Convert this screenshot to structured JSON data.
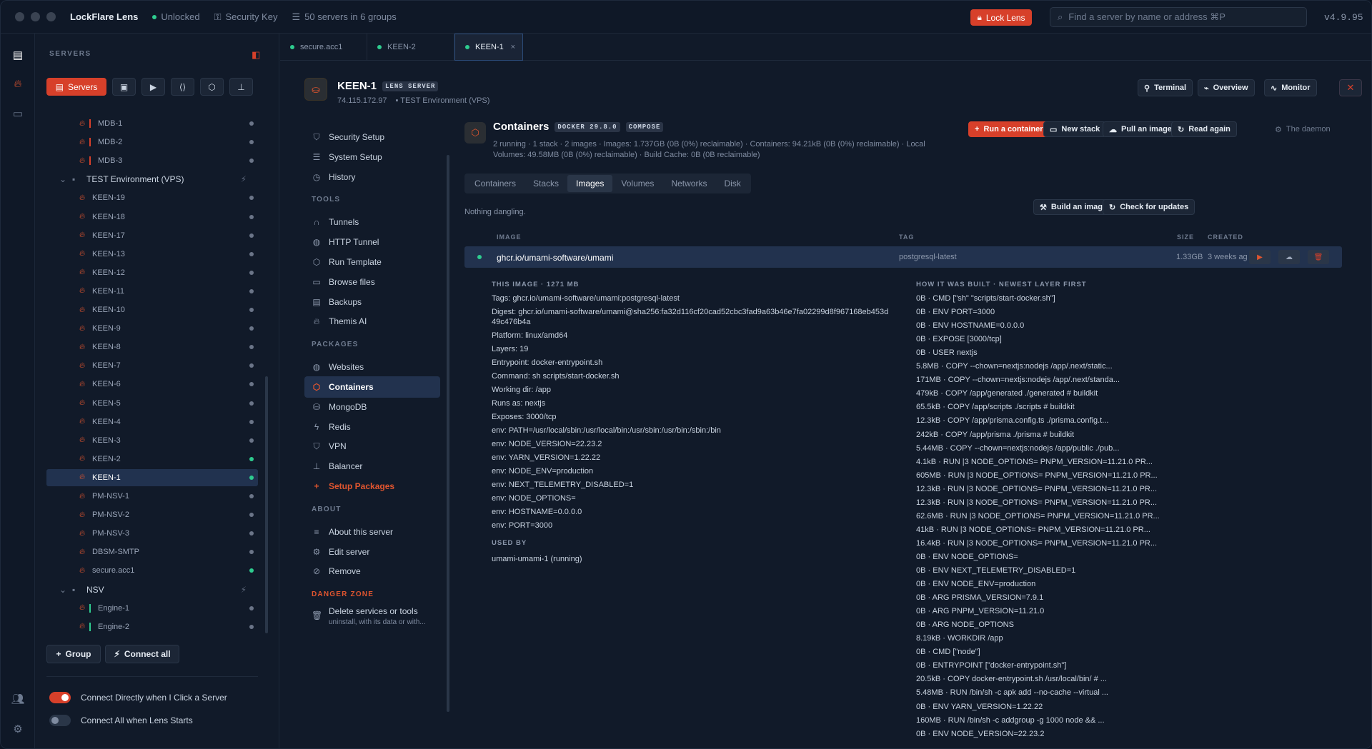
{
  "titlebar": {
    "app_name": "LockFlare Lens",
    "status": "Unlocked",
    "security_key": "Security Key",
    "servers_summary": "50 servers in 6 groups",
    "lock_btn": "Lock Lens",
    "search_placeholder": "Find a server by name or address ⌘P",
    "version": "v4.9.95"
  },
  "sidebar": {
    "title": "SERVERS",
    "servers_tab": "Servers",
    "tree": [
      {
        "label": "MDB-1",
        "kind": "server",
        "bar": "red",
        "on": false
      },
      {
        "label": "MDB-2",
        "kind": "server",
        "bar": "red",
        "on": false
      },
      {
        "label": "MDB-3",
        "kind": "server",
        "bar": "red",
        "on": false
      },
      {
        "label": "TEST Environment (VPS)",
        "kind": "group"
      },
      {
        "label": "KEEN-19",
        "kind": "server",
        "on": false
      },
      {
        "label": "KEEN-18",
        "kind": "server",
        "on": false
      },
      {
        "label": "KEEN-17",
        "kind": "server",
        "on": false
      },
      {
        "label": "KEEN-13",
        "kind": "server",
        "on": false
      },
      {
        "label": "KEEN-12",
        "kind": "server",
        "on": false
      },
      {
        "label": "KEEN-11",
        "kind": "server",
        "on": false
      },
      {
        "label": "KEEN-10",
        "kind": "server",
        "on": false
      },
      {
        "label": "KEEN-9",
        "kind": "server",
        "on": false
      },
      {
        "label": "KEEN-8",
        "kind": "server",
        "on": false
      },
      {
        "label": "KEEN-7",
        "kind": "server",
        "on": false
      },
      {
        "label": "KEEN-6",
        "kind": "server",
        "on": false
      },
      {
        "label": "KEEN-5",
        "kind": "server",
        "on": false
      },
      {
        "label": "KEEN-4",
        "kind": "server",
        "on": false
      },
      {
        "label": "KEEN-3",
        "kind": "server",
        "on": false
      },
      {
        "label": "KEEN-2",
        "kind": "server",
        "on": true
      },
      {
        "label": "KEEN-1",
        "kind": "server",
        "on": true,
        "selected": true
      },
      {
        "label": "PM-NSV-1",
        "kind": "server",
        "on": false
      },
      {
        "label": "PM-NSV-2",
        "kind": "server",
        "on": false
      },
      {
        "label": "PM-NSV-3",
        "kind": "server",
        "on": false
      },
      {
        "label": "DBSM-SMTP",
        "kind": "server",
        "on": false
      },
      {
        "label": "secure.acc1",
        "kind": "server",
        "on": true
      },
      {
        "label": "NSV",
        "kind": "group"
      },
      {
        "label": "Engine-1",
        "kind": "server",
        "bar": "green",
        "on": false
      },
      {
        "label": "Engine-2",
        "kind": "server",
        "bar": "green",
        "on": false
      }
    ],
    "group_btn": "Group",
    "connect_all_btn": "Connect all",
    "toggle1": "Connect Directly when I Click a Server",
    "toggle2": "Connect All when Lens Starts"
  },
  "tabs": [
    {
      "label": "secure.acc1",
      "active": false
    },
    {
      "label": "KEEN-2",
      "active": false
    },
    {
      "label": "KEEN-1",
      "active": true
    }
  ],
  "server": {
    "name": "KEEN-1",
    "badge": "LENS SERVER",
    "ip": "74.115.172.97",
    "env": "TEST Environment (VPS)",
    "btn_terminal": "Terminal",
    "btn_overview": "Overview",
    "btn_monitor": "Monitor"
  },
  "menu": {
    "items_top": [
      {
        "label": "Security Setup",
        "icon": "shield-icon"
      },
      {
        "label": "System Setup",
        "icon": "sliders-icon"
      },
      {
        "label": "History",
        "icon": "clock-icon"
      }
    ],
    "tools_head": "TOOLS",
    "tools": [
      {
        "label": "Tunnels",
        "icon": "tunnel-icon"
      },
      {
        "label": "HTTP Tunnel",
        "icon": "globe-icon"
      },
      {
        "label": "Run Template",
        "icon": "box-icon"
      },
      {
        "label": "Browse files",
        "icon": "folder-icon"
      },
      {
        "label": "Backups",
        "icon": "archive-icon"
      },
      {
        "label": "Themis AI",
        "icon": "flame-icon"
      }
    ],
    "packages_head": "PACKAGES",
    "packages": [
      {
        "label": "Websites",
        "icon": "globe-icon"
      },
      {
        "label": "Containers",
        "icon": "container-icon",
        "active": true
      },
      {
        "label": "MongoDB",
        "icon": "database-icon"
      },
      {
        "label": "Redis",
        "icon": "bolt-icon"
      },
      {
        "label": "VPN",
        "icon": "shield-icon"
      },
      {
        "label": "Balancer",
        "icon": "network-icon"
      },
      {
        "label": "Setup Packages",
        "icon": "plus-icon",
        "orange": true
      }
    ],
    "about_head": "ABOUT",
    "about": [
      {
        "label": "About this server",
        "icon": "list-icon"
      },
      {
        "label": "Edit server",
        "icon": "gear-icon"
      },
      {
        "label": "Remove",
        "icon": "ban-icon"
      }
    ],
    "danger_head": "DANGER ZONE",
    "danger_label": "Delete services or tools",
    "danger_sub": "uninstall, with its data or with..."
  },
  "containers": {
    "title": "Containers",
    "docker_badge": "DOCKER 29.8.0",
    "compose_badge": "COMPOSE",
    "sub1": "2 running · 1 stack · 2 images · Images: 1.737GB (0B (0%) reclaimable) · Containers: 94.21kB (0B (0%) reclaimable) · Local",
    "sub2": "Volumes: 49.58MB (0B (0%) reclaimable) · Build Cache: 0B (0B reclaimable)",
    "btn_run": "Run a container",
    "btn_new_stack": "New stack",
    "btn_pull": "Pull an image",
    "btn_read": "Read again",
    "daemon": "The daemon",
    "subtabs": [
      "Containers",
      "Stacks",
      "Images",
      "Volumes",
      "Networks",
      "Disk"
    ],
    "active_subtab": "Images",
    "note": "Nothing dangling.",
    "btn_build": "Build an image",
    "btn_check": "Check for updates",
    "col_image": "IMAGE",
    "col_tag": "TAG",
    "col_size": "SIZE",
    "col_created": "CREATED",
    "row": {
      "image": "ghcr.io/umami-software/umami",
      "tag": "postgresql-latest",
      "size": "1.33GB",
      "created": "3 weeks ag"
    },
    "this_image_head": "THIS IMAGE · 1271 MB",
    "details": [
      "Tags: ghcr.io/umami-software/umami:postgresql-latest",
      "Digest: ghcr.io/umami-software/umami@sha256:fa32d116cf20cad52cbc3fad9a63b46e7fa02299d8f967168eb453d",
      "49c476b4a",
      "Platform: linux/amd64",
      "Layers: 19",
      "Entrypoint: docker-entrypoint.sh",
      "Command: sh scripts/start-docker.sh",
      "Working dir: /app",
      "Runs as: nextjs",
      "Exposes: 3000/tcp",
      "env: PATH=/usr/local/sbin:/usr/local/bin:/usr/sbin:/usr/bin:/sbin:/bin",
      "env: NODE_VERSION=22.23.2",
      "env: YARN_VERSION=1.22.22",
      "env: NODE_ENV=production",
      "env: NEXT_TELEMETRY_DISABLED=1",
      "env: NODE_OPTIONS=",
      "env: HOSTNAME=0.0.0.0",
      "env: PORT=3000"
    ],
    "used_by_head": "USED BY",
    "used_by": "umami-umami-1 (running)",
    "layers_head": "HOW IT WAS BUILT · NEWEST LAYER FIRST",
    "layers": [
      "0B · CMD [\"sh\" \"scripts/start-docker.sh\"]",
      "0B · ENV PORT=3000",
      "0B · ENV HOSTNAME=0.0.0.0",
      "0B · EXPOSE [3000/tcp]",
      "0B · USER nextjs",
      "5.8MB · COPY --chown=nextjs:nodejs /app/.next/static...",
      "171MB · COPY --chown=nextjs:nodejs /app/.next/standa...",
      "479kB · COPY /app/generated ./generated # buildkit",
      "65.5kB · COPY /app/scripts ./scripts # buildkit",
      "12.3kB · COPY /app/prisma.config.ts ./prisma.config.t...",
      "242kB · COPY /app/prisma ./prisma # buildkit",
      "5.44MB · COPY --chown=nextjs:nodejs /app/public ./pub...",
      "4.1kB · RUN |3 NODE_OPTIONS= PNPM_VERSION=11.21.0 PR...",
      "605MB · RUN |3 NODE_OPTIONS= PNPM_VERSION=11.21.0 PR...",
      "12.3kB · RUN |3 NODE_OPTIONS= PNPM_VERSION=11.21.0 PR...",
      "12.3kB · RUN |3 NODE_OPTIONS= PNPM_VERSION=11.21.0 PR...",
      "62.6MB · RUN |3 NODE_OPTIONS= PNPM_VERSION=11.21.0 PR...",
      "41kB · RUN |3 NODE_OPTIONS= PNPM_VERSION=11.21.0 PR...",
      "16.4kB · RUN |3 NODE_OPTIONS= PNPM_VERSION=11.21.0 PR...",
      "0B · ENV NODE_OPTIONS=",
      "0B · ENV NEXT_TELEMETRY_DISABLED=1",
      "0B · ENV NODE_ENV=production",
      "0B · ARG PRISMA_VERSION=7.9.1",
      "0B · ARG PNPM_VERSION=11.21.0",
      "0B · ARG NODE_OPTIONS",
      "8.19kB · WORKDIR /app",
      "0B · CMD [\"node\"]",
      "0B · ENTRYPOINT [\"docker-entrypoint.sh\"]",
      "20.5kB · COPY docker-entrypoint.sh /usr/local/bin/ # ...",
      "5.48MB · RUN /bin/sh -c apk add --no-cache --virtual ...",
      "0B · ENV YARN_VERSION=1.22.22",
      "160MB · RUN /bin/sh -c addgroup -g 1000 node && ...",
      "0B · ENV NODE_VERSION=22.23.2"
    ]
  }
}
